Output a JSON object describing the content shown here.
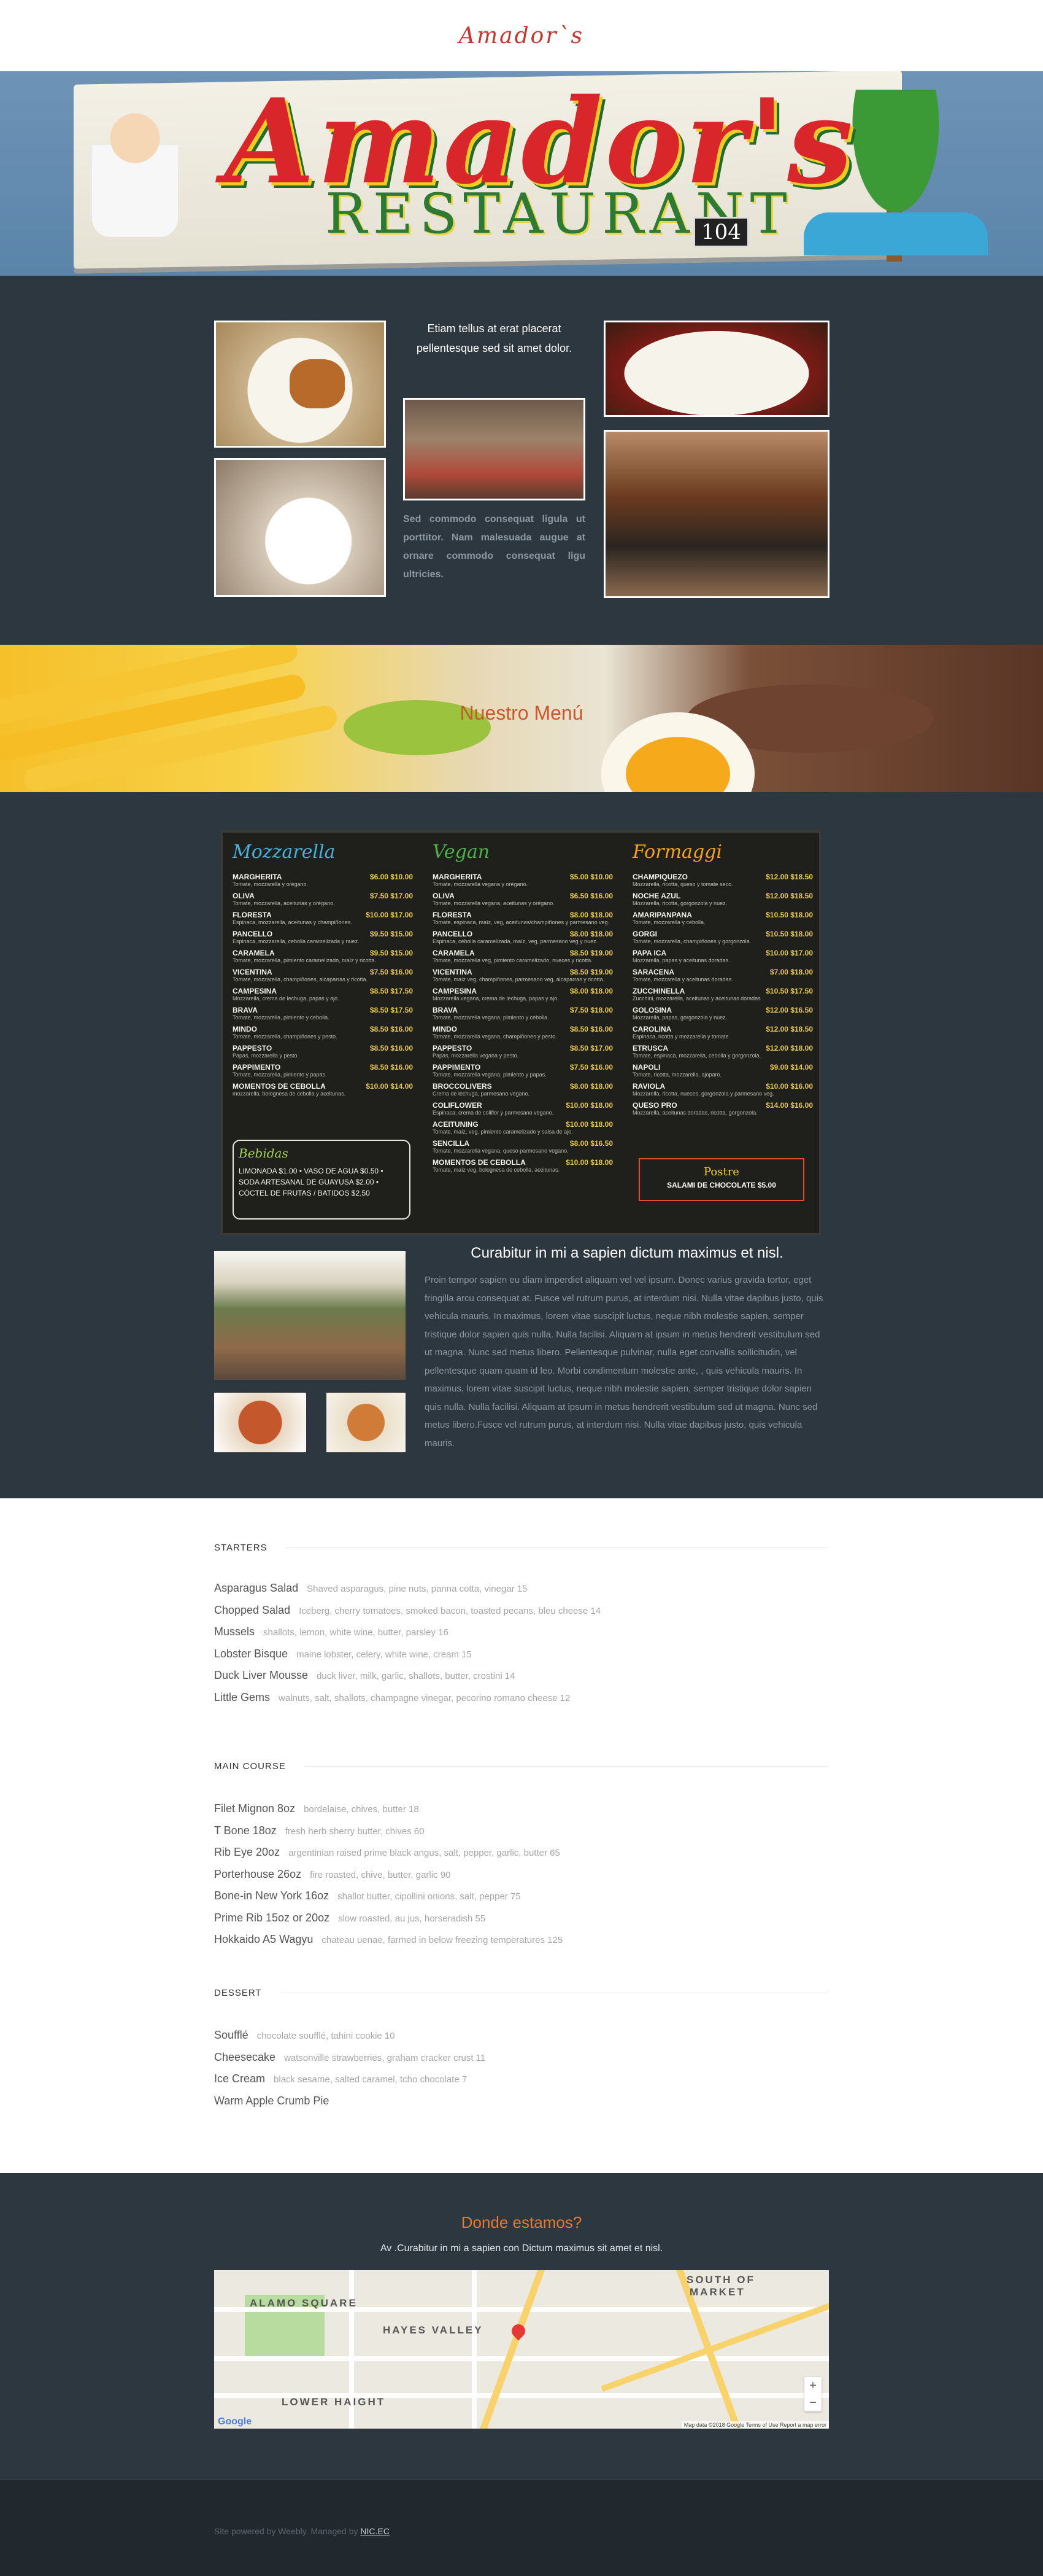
{
  "header": {
    "site_title": "Amador`s"
  },
  "banner": {
    "logo_text": "Amador's",
    "sub_text": "RESTAURANT",
    "number": "104"
  },
  "gallery": {
    "text_top": "Etiam tellus at erat placerat pellentesque sed sit amet dolor.",
    "text_bottom": "Sed commodo consequat ligula ut porttitor. Nam malesuada augue at ornare commodo consequat ligu ultricies."
  },
  "menu_banner": {
    "title": "Nuestro Menú"
  },
  "menu_board": {
    "columns": [
      {
        "heading": "Mozzarella",
        "color": "#4ab0d9",
        "items": [
          {
            "name": "MARGHERITA",
            "price": "$6.00 $10.00",
            "desc": "Tomate, mozzarella y orégano."
          },
          {
            "name": "OLIVA",
            "price": "$7.50 $17.00",
            "desc": "Tomate, mozzarella, aceitunas y orégano."
          },
          {
            "name": "FLORESTA",
            "price": "$10.00 $17.00",
            "desc": "Espinaca, mozzarella, aceitunas y champiñones."
          },
          {
            "name": "PANCELLO",
            "price": "$9.50 $15.00",
            "desc": "Espinaca, mozzarella, cebolla caramelizada y nuez."
          },
          {
            "name": "CARAMELA",
            "price": "$9.50 $15.00",
            "desc": "Tomate, mozzarella, pimiento caramelizado, maíz y ricotta."
          },
          {
            "name": "VICENTINA",
            "price": "$7.50 $16.00",
            "desc": "Tomate, mozzarella, champiñones, alcaparras y ricotta."
          },
          {
            "name": "CAMPESINA",
            "price": "$8.50 $17.50",
            "desc": "Mozzarella, crema de lechuga, papas y ajo."
          },
          {
            "name": "BRAVA",
            "price": "$8.50 $17.50",
            "desc": "Tomate, mozzarella, pimiento y cebolla."
          },
          {
            "name": "MINDO",
            "price": "$8.50 $16.00",
            "desc": "Tomate, mozzarella, champiñones y pesto."
          },
          {
            "name": "PAPPESTO",
            "price": "$8.50 $16.00",
            "desc": "Papas, mozzarella y pesto."
          },
          {
            "name": "PAPPIMENTO",
            "price": "$8.50 $16.00",
            "desc": "Tomate, mozzarella, pimiento y papas."
          },
          {
            "name": "MOMENTOS DE CEBOLLA",
            "price": "$10.00 $14.00",
            "desc": "mozzarella, bolognesa de cebolla y aceitunas."
          }
        ]
      },
      {
        "heading": "Vegan",
        "color": "#4fb14a",
        "items": [
          {
            "name": "MARGHERITA",
            "price": "$5.00 $10.00",
            "desc": "Tomate, mozzarella vegana y orégano."
          },
          {
            "name": "OLIVA",
            "price": "$6.50 $16.00",
            "desc": "Tomate, mozzarella vegana, aceitunas y orégano."
          },
          {
            "name": "FLORESTA",
            "price": "$8.00 $18.00",
            "desc": "Tomate, espinaca, maíz, veg, aceitunas/champiñones y parmesano veg."
          },
          {
            "name": "PANCELLO",
            "price": "$8.00 $18.00",
            "desc": "Espinaca, cebolla caramelizada, maíz, veg, parmesano veg y nuez."
          },
          {
            "name": "CARAMELA",
            "price": "$8.50 $19.00",
            "desc": "Tomate, mozzarella veg, pimiento caramelizado, nueces y ricotta."
          },
          {
            "name": "VICENTINA",
            "price": "$8.50 $19.00",
            "desc": "Tomate, maíz veg, champiñones, parmesano veg, alcaparras y ricotta."
          },
          {
            "name": "CAMPESINA",
            "price": "$8.00 $18.00",
            "desc": "Mozzarella vegana, crema de lechuga, papas y ajo."
          },
          {
            "name": "BRAVA",
            "price": "$7.50 $18.00",
            "desc": "Tomate, mozzarella vegana, pimiento y cebolla."
          },
          {
            "name": "MINDO",
            "price": "$8.50 $16.00",
            "desc": "Tomate, mozzarella vegana, champiñones y pesto."
          },
          {
            "name": "PAPPESTO",
            "price": "$8.50 $17.00",
            "desc": "Papas, mozzarella vegana y pesto."
          },
          {
            "name": "PAPPIMENTO",
            "price": "$7.50 $16.00",
            "desc": "Tomate, mozzarella vegana, pimiento y papas."
          },
          {
            "name": "BROCCOLIVERS",
            "price": "$8.00 $18.00",
            "desc": "Crema de lechuga, parmesano vegano."
          },
          {
            "name": "COLIFLOWER",
            "price": "$10.00 $18.00",
            "desc": "Espinaca, crema de coliflor y parmesano vegano."
          },
          {
            "name": "ACEITUNING",
            "price": "$10.00 $18.00",
            "desc": "Tomate, maíz, veg, pimiento caramelizado y salsa de ajo."
          },
          {
            "name": "SENCILLA",
            "price": "$8.00 $16.50",
            "desc": "Tomate, mozzarella vegana, queso parmesano vegano."
          },
          {
            "name": "MOMENTOS DE CEBOLLA",
            "price": "$10.00 $18.00",
            "desc": "Tomate, maíz veg, bolognesa de cebolla, aceitunas."
          }
        ]
      },
      {
        "heading": "Formaggi",
        "color": "#f3a21b",
        "items": [
          {
            "name": "CHAMPIQUEZO",
            "price": "$12.00 $18.50",
            "desc": "Mozzarella, ricotta, queso y tomate seco."
          },
          {
            "name": "NOCHE AZUL",
            "price": "$12.00 $18.50",
            "desc": "Mozzarella, ricotta, gorgonzola y nuez."
          },
          {
            "name": "AMARIPANPANA",
            "price": "$10.50 $18.00",
            "desc": "Tomate, mozzarella y cebolla."
          },
          {
            "name": "GORGI",
            "price": "$10.50 $18.00",
            "desc": "Tomate, mozzarella, champiñones y gorgonzola."
          },
          {
            "name": "PAPA ICA",
            "price": "$10.00 $17.00",
            "desc": "Mozzarella, papas y aceitunas doradas."
          },
          {
            "name": "SARACENA",
            "price": "$7.00 $18.00",
            "desc": "Tomate, mozzarella y aceitunas doradas."
          },
          {
            "name": "ZUCCHINELLA",
            "price": "$10.50 $17.50",
            "desc": "Zucchini, mozzarella, aceitunas y aceitunas doradas."
          },
          {
            "name": "GOLOSINA",
            "price": "$12.00 $16.50",
            "desc": "Mozzarella, papas, gorgonzola y nuez."
          },
          {
            "name": "CAROLINA",
            "price": "$12.00 $18.50",
            "desc": "Espinaca, ricotta y mozzarella y tomate."
          },
          {
            "name": "ETRUSCA",
            "price": "$12.00 $18.00",
            "desc": "Tomate, espinaca, mozzarella, cebolla y gorgonzola."
          },
          {
            "name": "NAPOLI",
            "price": "$9.00 $14.00",
            "desc": "Tomate, ricotta, mozzarella, ajoparo."
          },
          {
            "name": "RAVIOLA",
            "price": "$10.00 $16.00",
            "desc": "Mozzarella, ricotta, nueces, gorgonzola y parmesano veg."
          },
          {
            "name": "QUESO PRO",
            "price": "$14.00 $16.00",
            "desc": "Mozzarella, aceitunas doradas, ricotta, gorgonzola."
          }
        ]
      }
    ],
    "drinks_title": "Bebidas",
    "drinks_text": "LIMONADA $1.00  •  VASO DE AGUA $0.50  •  SODA ARTESANAL DE GUAYUSA $2.00  •  CÓCTEL DE FRUTAS / BATIDOS $2.50",
    "postre_title": "Postre",
    "postre_item": "SALAMI DE CHOCOLATE $5.00"
  },
  "menu_info": {
    "heading": "Curabitur in mi a sapien dictum maximus et nisl.",
    "paragraph": "Proin tempor sapien eu diam imperdiet aliquam vel vel ipsum. Donec varius gravida tortor, eget fringilla arcu consequat at. Fusce vel rutrum purus, at interdum nisi. Nulla vitae dapibus justo, quis vehicula mauris. In maximus, lorem vitae suscipit luctus, neque nibh molestie sapien, semper tristique dolor sapien quis nulla. Nulla facilisi. Aliquam at ipsum in metus hendrerit vestibulum sed ut magna. Nunc sed metus libero. Pellentesque pulvinar, nulla eget convallis sollicitudin, vel pellentesque quam quam id leo. Morbi condimentum molestie ante, , quis vehicula mauris. In maximus, lorem vitae suscipit luctus, neque nibh molestie sapien, semper tristique dolor sapien quis nulla. Nulla facilisi. Aliquam at ipsum in metus hendrerit vestibulum sed ut magna. Nunc sed metus libero.Fusce vel rutrum purus, at interdum nisi. Nulla vitae dapibus justo, quis vehicula mauris."
  },
  "menu_list": {
    "categories": [
      {
        "title": "STARTERS",
        "items": [
          {
            "name": "Asparagus Salad",
            "desc": "Shaved asparagus, pine nuts, panna cotta, vinegar  15"
          },
          {
            "name": "Chopped Salad",
            "desc": "Iceberg, cherry tomatoes, smoked bacon, toasted pecans, bleu cheese  14"
          },
          {
            "name": "Mussels",
            "desc": "shallots, lemon, white wine, butter, parsley  16"
          },
          {
            "name": "Lobster Bisque",
            "desc": "maine lobster, celery, white wine, cream  15"
          },
          {
            "name": "Duck Liver Mousse",
            "desc": "duck liver, milk, garlic, shallots, butter, crostini  14"
          },
          {
            "name": "Little Gems",
            "desc": "walnuts, salt, shallots, champagne vinegar, pecorino romano cheese  12"
          }
        ]
      },
      {
        "title": "MAIN COURSE",
        "items": [
          {
            "name": "Filet Mignon 8oz",
            "desc": "bordelaise, chives, butter  18"
          },
          {
            "name": "T Bone 18oz",
            "desc": "fresh herb sherry butter, chives  60"
          },
          {
            "name": "Rib Eye 20oz",
            "desc": "argentinian raised prime black angus, salt, pepper, garlic, butter  65"
          },
          {
            "name": "Porterhouse 26oz",
            "desc": "fire roasted, chive, butter, garlic  90"
          },
          {
            "name": "Bone-in New York 16oz",
            "desc": "shallot butter, cipollini onions, salt, pepper  75"
          },
          {
            "name": "Prime Rib 15oz or 20oz",
            "desc": "slow roasted, au jus, horseradish  55"
          },
          {
            "name": "Hokkaido A5 Wagyu",
            "desc": "chateau uenae, farmed in below freezing temperatures  125"
          }
        ]
      },
      {
        "title": "DESSERT",
        "items": [
          {
            "name": "Soufflé",
            "desc": "chocolate soufflé, tahini cookie  10"
          },
          {
            "name": "Cheesecake",
            "desc": "watsonville strawberries, graham cracker crust  11"
          },
          {
            "name": "Ice Cream",
            "desc": "black sesame, salted caramel, tcho chocolate  7"
          },
          {
            "name": "Warm Apple Crumb Pie",
            "desc": ""
          }
        ]
      }
    ]
  },
  "location": {
    "title": "Donde estamos?",
    "subtitle": "Av .Curabitur in mi a sapien con Dictum maximus sit amet et nisl.",
    "map_labels": [
      "ALAMO SQUARE",
      "HAYES VALLEY",
      "LOWER HAIGHT",
      "SOUTH OF",
      "MARKET"
    ],
    "map_attribution": "Map data ©2018 Google   Terms of Use   Report a map error",
    "google_logo": "Google",
    "zoom_in": "+",
    "zoom_out": "−"
  },
  "footer": {
    "text": "Site powered by Weebly. Managed by ",
    "link_text": "NIC.EC"
  },
  "colors": {
    "dark_bg": "#2c3740",
    "accent_orange": "#e8782f",
    "title_red": "#c8352f"
  }
}
